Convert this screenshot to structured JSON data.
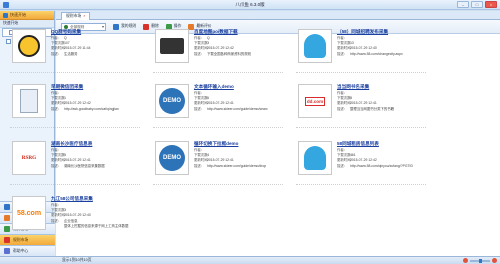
{
  "window": {
    "title": "八爪鱼 6.3.0版",
    "controls": [
      "–",
      "□",
      "×"
    ]
  },
  "sidebar": {
    "header": "快速开始",
    "sub": "快速开始",
    "items": [
      {
        "label": "我的任务"
      },
      {
        "label": "我的下载"
      }
    ],
    "nav": [
      {
        "label": "快速开始"
      },
      {
        "label": "我的任务"
      },
      {
        "label": "任务管理"
      },
      {
        "label": "规则市场"
      },
      {
        "label": "帮助中心"
      }
    ]
  },
  "tabs": [
    {
      "label": "规则市场",
      "close": "×"
    }
  ],
  "toolbar": {
    "select_placeholder": "全部规则",
    "buttons": [
      {
        "label": "我的规则"
      },
      {
        "label": "删除"
      },
      {
        "label": "操作"
      },
      {
        "label": "最新评价"
      }
    ]
  },
  "field_labels": {
    "author": "作者：",
    "downloads": "下载次数：",
    "updated": "更新时间：",
    "desc": "描述："
  },
  "cards": [
    {
      "title": "QQ群号码采集",
      "author": "Q",
      "downloads": "107",
      "updated": "2015-07-29 11:44",
      "desc": "生活服务",
      "thumb": "qq"
    },
    {
      "title": "百度地图poi数据下载",
      "author": "Q",
      "downloads": "3",
      "updated": "2015-07-29 12:42",
      "desc": "下载全国各种商家资料的规则",
      "thumb": "baidu"
    },
    {
      "title": "（58）同城招聘发布采集",
      "author": "",
      "downloads": "13",
      "updated": "2015-07-29 12:40",
      "desc": "http://www.58.com/changecity.aspx",
      "thumb": "octo"
    },
    {
      "title": "早期微信团采集",
      "author": "",
      "downloads": "1",
      "updated": "2015-07-29 12:42",
      "desc": "http://ask.goodbaby.com/cat/qingjian",
      "thumb": "doc"
    },
    {
      "title": "文本循环输入demo",
      "author": "",
      "downloads": "6",
      "updated": "2015-07-29 12:41",
      "desc": "http://www.skieer.com/guide/demo/searc",
      "thumb": "demo"
    },
    {
      "title": "当当网书名采集",
      "author": "",
      "downloads": "8",
      "updated": "2015-07-29 12:41",
      "desc": "整理当当网图书分类下的书籍",
      "thumb": "dd"
    },
    {
      "title": "湖南长沙医疗信息表",
      "author": "",
      "downloads": "5",
      "updated": "2015-07-29 12:41",
      "desc": "湖南长沙医院信息采集数据",
      "thumb": "red"
    },
    {
      "title": "循环切换下拉框demo",
      "author": "",
      "downloads": "4",
      "updated": "2015-07-29 12:41",
      "desc": "http://www.skieer.com/guide/demo/drop",
      "thumb": "demo"
    },
    {
      "title": "58同城租房信息列表",
      "author": "",
      "downloads": "461",
      "updated": "2015-07-29 12:42",
      "desc": "http://www.58.com/qinyou/zufang/?PGTID",
      "thumb": "octo"
    },
    {
      "title": "九江58公司信息采集",
      "author": "",
      "downloads": "3",
      "updated": "2015-07-29 12:40",
      "desc": "企业信息",
      "thumb": "58",
      "extra": "整体上挖掘的信息来源于网上工商主体数据"
    }
  ],
  "status": {
    "text": "显示1到10共10页"
  },
  "colors": {
    "accent": "#f2a93b",
    "link": "#1a3f9e",
    "frame": "#9ab7da"
  }
}
